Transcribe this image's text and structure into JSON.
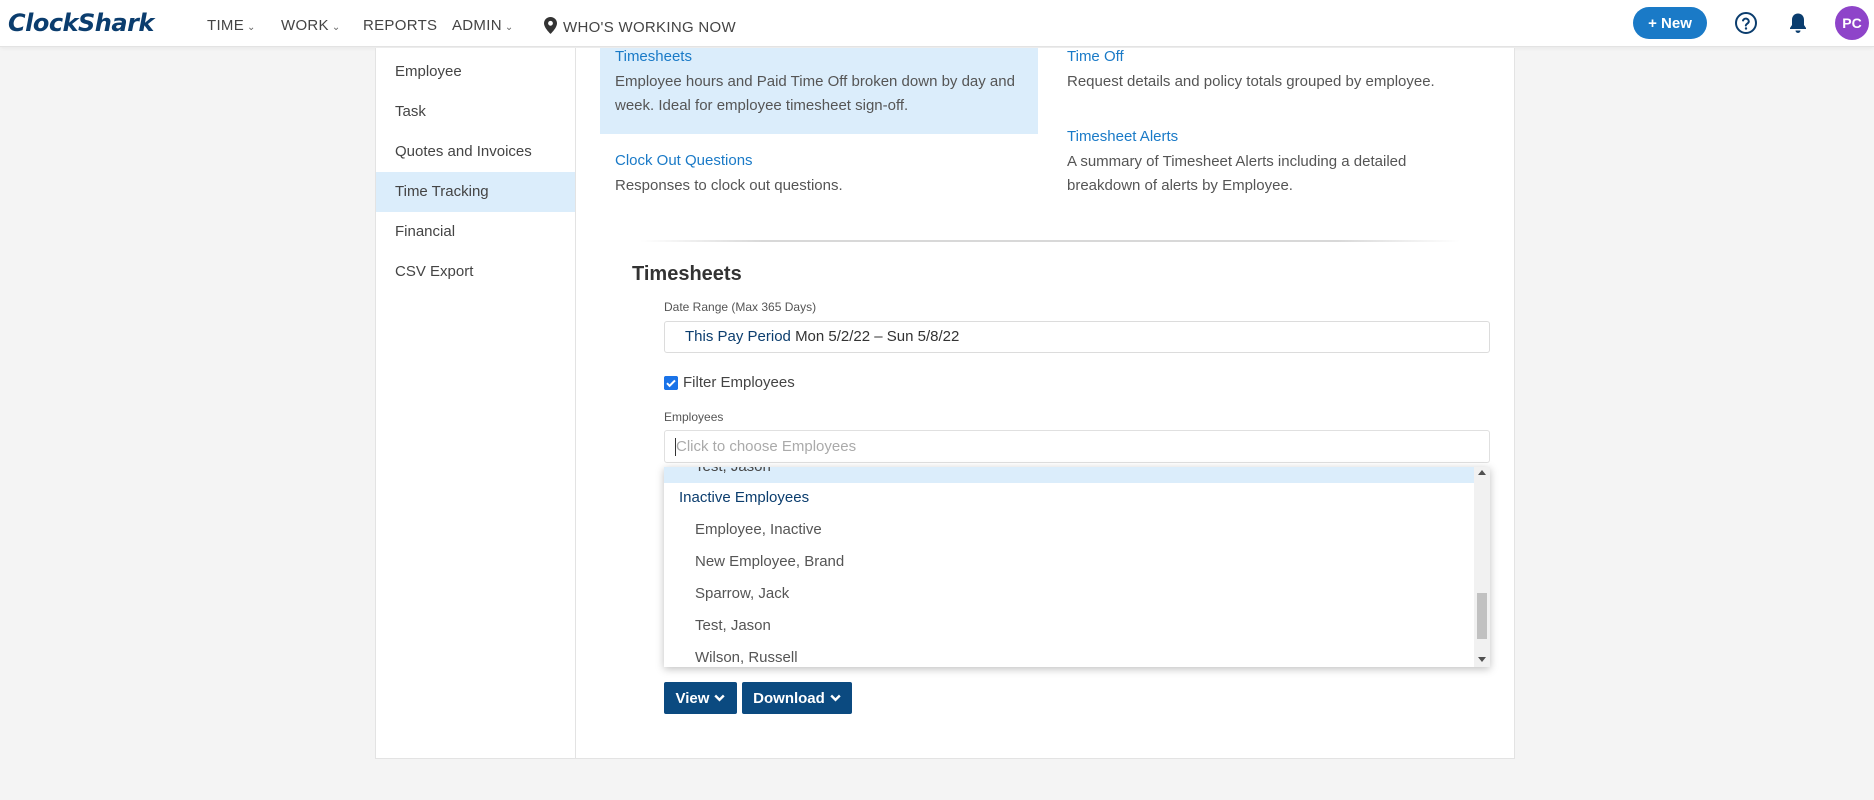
{
  "app": {
    "logo": "ClockShark"
  },
  "nav": {
    "items": [
      {
        "label": "TIME"
      },
      {
        "label": "WORK"
      },
      {
        "label": "REPORTS"
      },
      {
        "label": "ADMIN"
      },
      {
        "label": "WHO'S WORKING NOW"
      }
    ],
    "new_button": "+ New",
    "avatar_initials": "PC"
  },
  "sidebar": {
    "items": [
      {
        "label": "Employee"
      },
      {
        "label": "Task"
      },
      {
        "label": "Quotes and Invoices"
      },
      {
        "label": "Time Tracking"
      },
      {
        "label": "Financial"
      },
      {
        "label": "CSV Export"
      }
    ],
    "active": "Time Tracking"
  },
  "reports": [
    {
      "title": "Timesheets",
      "description": "Employee hours and Paid Time Off broken down by day and week. Ideal for employee timesheet sign-off."
    },
    {
      "title": "Time Off",
      "description": "Request details and policy totals grouped by employee."
    },
    {
      "title": "Clock Out Questions",
      "description": "Responses to clock out questions."
    },
    {
      "title": "Timesheet Alerts",
      "description": "A summary of Timesheet Alerts including a detailed breakdown of alerts by Employee."
    }
  ],
  "form": {
    "section_title": "Timesheets",
    "date_range_label": "Date Range (Max 365 Days)",
    "date_period": "This Pay Period",
    "date_range": "Mon 5/2/22 – Sun 5/8/22",
    "filter_label": "Filter Employees",
    "filter_checked": true,
    "employees_label": "Employees",
    "employees_placeholder": "Click to choose Employees"
  },
  "dropdown": {
    "highlighted_option": "Test, Jason",
    "group_label": "Inactive Employees",
    "options": [
      {
        "label": "Employee, Inactive"
      },
      {
        "label": "New Employee, Brand"
      },
      {
        "label": "Sparrow, Jack"
      },
      {
        "label": "Test, Jason"
      },
      {
        "label": "Wilson, Russell"
      }
    ]
  },
  "actions": {
    "view_label": "View",
    "download_label": "Download"
  },
  "colors": {
    "brand_navy": "#0b3d6e",
    "link_blue": "#1a7ac7",
    "active_bg": "#dbedfb",
    "button_navy": "#0b4a80",
    "avatar_purple": "#8e44c9"
  }
}
